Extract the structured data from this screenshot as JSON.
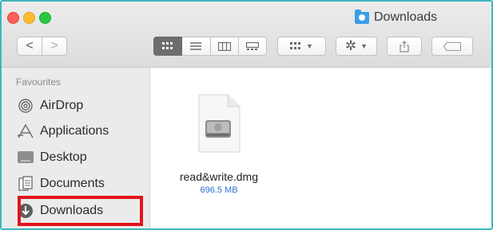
{
  "window": {
    "title": "Downloads"
  },
  "toolbar": {
    "nav": {
      "back": "<",
      "forward": ">"
    },
    "views": [
      "icon-view-icon",
      "list-view-icon",
      "column-view-icon",
      "gallery-view-icon"
    ],
    "group_icon": "group-by-icon",
    "action_icon": "gear-icon",
    "share_icon": "share-icon",
    "tag_icon": "tag-icon"
  },
  "sidebar": {
    "header": "Favourites",
    "items": [
      {
        "label": "AirDrop",
        "icon": "airdrop-icon"
      },
      {
        "label": "Applications",
        "icon": "applications-icon"
      },
      {
        "label": "Desktop",
        "icon": "desktop-icon"
      },
      {
        "label": "Documents",
        "icon": "documents-icon"
      },
      {
        "label": "Downloads",
        "icon": "downloads-icon"
      }
    ]
  },
  "files": [
    {
      "name": "read&write.dmg",
      "size": "696.5 MB",
      "icon": "disk-image-icon"
    }
  ],
  "colors": {
    "highlight": "#e3141a",
    "size_text": "#2f6fd6",
    "frame": "#3fb6c0"
  }
}
